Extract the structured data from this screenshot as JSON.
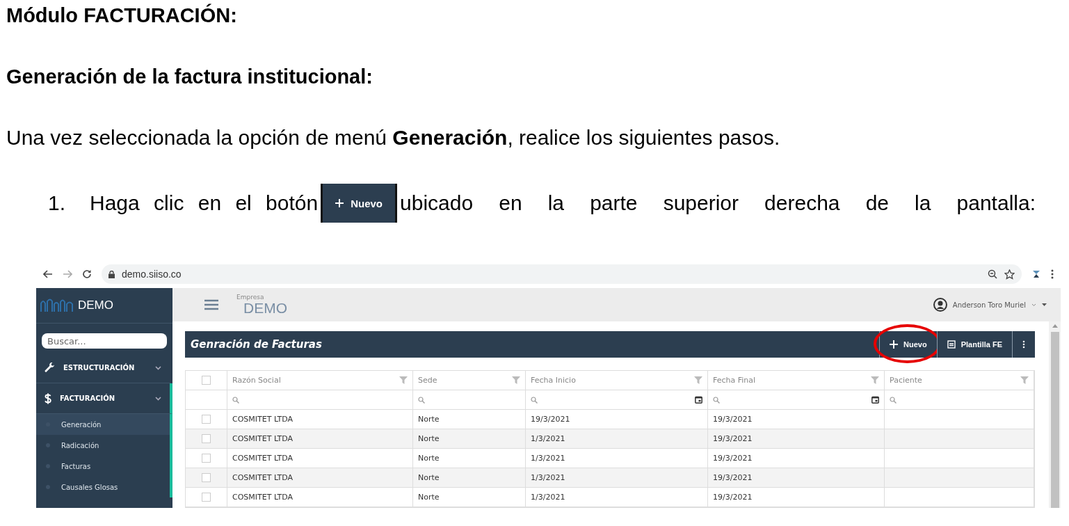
{
  "document": {
    "heading": "Módulo FACTURACIÓN:",
    "subheading": "Generación de la factura institucional:",
    "intro": "Una vez seleccionada la opción de menú **Generación**, realice los siguientes pasos.",
    "steps": [
      {
        "number": "1.",
        "text_before": "Haga clic en el botón",
        "button_label": "Nuevo",
        "text_after": "ubicado en la parte superior derecha de la pantalla:"
      }
    ]
  },
  "browser": {
    "url": "demo.siiso.co"
  },
  "sidebar": {
    "brand": "DEMO",
    "search": {
      "placeholder": "Buscar..."
    },
    "menu": [
      {
        "kind": "tools",
        "label": "ESTRUCTURACIÓN",
        "selected": false
      },
      {
        "kind": "billing",
        "label": "FACTURACIÓN",
        "selected": true,
        "expanded": true,
        "children": [
          {
            "label": "Generación",
            "selected": true
          },
          {
            "label": "Radicación",
            "selected": false
          },
          {
            "label": "Facturas",
            "selected": false
          },
          {
            "label": "Causales Glosas",
            "selected": false
          }
        ]
      }
    ]
  },
  "header": {
    "company_label": "Empresa",
    "company": "DEMO",
    "user": "Anderson Toro Muriel"
  },
  "panel": {
    "title": "Genración de Facturas",
    "buttons": [
      {
        "kind": "new",
        "label": "Nuevo",
        "highlighted": true
      },
      {
        "kind": "template",
        "label": "Plantilla FE",
        "highlighted": false
      },
      {
        "kind": "more",
        "highlighted": false
      }
    ]
  },
  "table": {
    "select_all": {
      "checked": false
    },
    "columns": [
      {
        "label": "Razón Social",
        "date_filter": false
      },
      {
        "label": "Sede",
        "date_filter": false
      },
      {
        "label": "Fecha Inicio",
        "date_filter": true
      },
      {
        "label": "Fecha Final",
        "date_filter": true
      },
      {
        "label": "Paciente",
        "date_filter": false
      }
    ],
    "rows": [
      {
        "checked": false,
        "cells": [
          "COSMITET LTDA",
          "Norte",
          "19/3/2021",
          "19/3/2021"
        ]
      },
      {
        "checked": false,
        "cells": [
          "COSMITET LTDA",
          "Norte",
          "1/3/2021",
          "19/3/2021"
        ]
      },
      {
        "checked": false,
        "cells": [
          "COSMITET LTDA",
          "Norte",
          "1/3/2021",
          "19/3/2021"
        ]
      },
      {
        "checked": false,
        "cells": [
          "COSMITET LTDA",
          "Norte",
          "1/3/2021",
          "19/3/2021"
        ]
      },
      {
        "checked": false,
        "cells": [
          "COSMITET LTDA",
          "Norte",
          "1/3/2021",
          "19/3/2021"
        ]
      }
    ]
  }
}
